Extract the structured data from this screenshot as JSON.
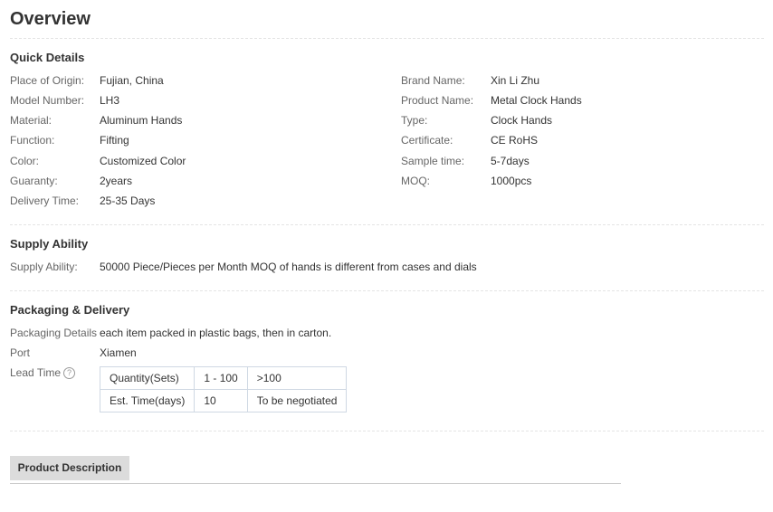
{
  "page_title": "Overview",
  "quick_details": {
    "title": "Quick Details",
    "left": [
      {
        "label": "Place of Origin:",
        "value": "Fujian, China"
      },
      {
        "label": "Model Number:",
        "value": "LH3"
      },
      {
        "label": "Material:",
        "value": "Aluminum Hands"
      },
      {
        "label": "Function:",
        "value": "Fifting"
      },
      {
        "label": "Color:",
        "value": "Customized Color"
      },
      {
        "label": "Guaranty:",
        "value": "2years"
      },
      {
        "label": "Delivery Time:",
        "value": "25-35 Days"
      }
    ],
    "right": [
      {
        "label": "Brand Name:",
        "value": "Xin Li Zhu"
      },
      {
        "label": "Product Name:",
        "value": "Metal Clock Hands"
      },
      {
        "label": "Type:",
        "value": "Clock Hands"
      },
      {
        "label": "Certificate:",
        "value": "CE RoHS"
      },
      {
        "label": "Sample time:",
        "value": "5-7days"
      },
      {
        "label": "MOQ:",
        "value": "1000pcs"
      }
    ]
  },
  "supply_ability": {
    "title": "Supply Ability",
    "label": "Supply Ability:",
    "value": "50000 Piece/Pieces per Month MOQ of hands is different from cases and dials"
  },
  "packaging": {
    "title": "Packaging & Delivery",
    "details_label": "Packaging Details",
    "details_value": "each item packed in plastic bags, then in carton.",
    "port_label": "Port",
    "port_value": "Xiamen",
    "lead_time_label": "Lead Time",
    "help_glyph": "?",
    "lead_table": [
      [
        "Quantity(Sets)",
        "1 - 100",
        ">100"
      ],
      [
        "Est. Time(days)",
        "10",
        "To be negotiated"
      ]
    ]
  },
  "product_description_tab": "Product Description",
  "icons": {
    "lead_time_help": "question-circle-icon"
  }
}
